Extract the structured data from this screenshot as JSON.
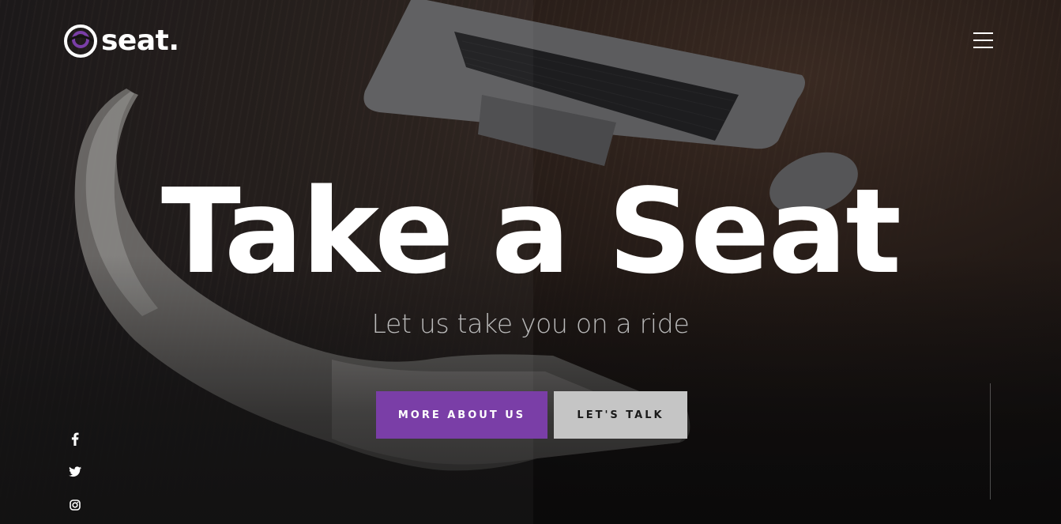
{
  "brand": {
    "name": "seat.",
    "accent_color": "#7a3ea7"
  },
  "header": {
    "menu_icon": "hamburger-menu-icon"
  },
  "hero": {
    "title": "Take a Seat",
    "subtitle": "Let us take you on a ride",
    "primary_button": "MORE ABOUT US",
    "secondary_button": "LET'S TALK"
  },
  "social": {
    "items": [
      {
        "icon": "facebook-icon"
      },
      {
        "icon": "twitter-icon"
      },
      {
        "icon": "instagram-icon"
      }
    ]
  },
  "colors": {
    "background": "#141213",
    "primary_button_bg": "#7a3ea7",
    "secondary_button_bg": "#c5c5c5",
    "text": "#ffffff",
    "subtitle_text": "#b9b9b9"
  }
}
